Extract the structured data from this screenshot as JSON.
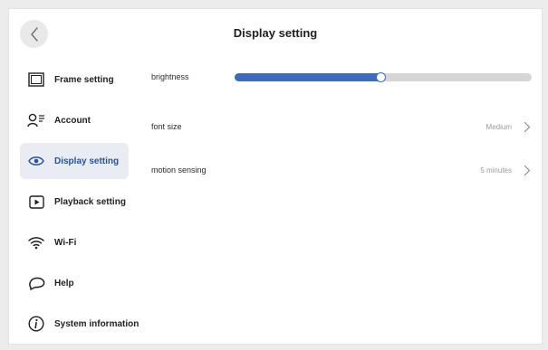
{
  "header": {
    "title": "Display setting"
  },
  "sidebar": {
    "items": [
      {
        "label": "Frame setting"
      },
      {
        "label": "Account"
      },
      {
        "label": "Display setting"
      },
      {
        "label": "Playback setting"
      },
      {
        "label": "Wi-Fi"
      },
      {
        "label": "Help"
      },
      {
        "label": "System information"
      }
    ],
    "active_index": 2
  },
  "settings": {
    "brightness": {
      "label": "brightness",
      "value_percent": 49
    },
    "font_size": {
      "label": "font size",
      "value": "Medium"
    },
    "motion_sensing": {
      "label": "motion sensing",
      "value": "5 minutes"
    }
  },
  "colors": {
    "accent": "#3a6bbf",
    "active_bg": "#e9edf3",
    "track": "#d6d6d6"
  },
  "icons": {
    "back": "chevron-left-icon",
    "frame_setting": "frame-icon",
    "account": "account-list-icon",
    "display_setting": "eye-icon",
    "playback_setting": "play-icon",
    "wifi": "wifi-icon",
    "help": "chat-bubble-icon",
    "system_information": "info-icon",
    "row_chevron": "chevron-right-icon"
  }
}
